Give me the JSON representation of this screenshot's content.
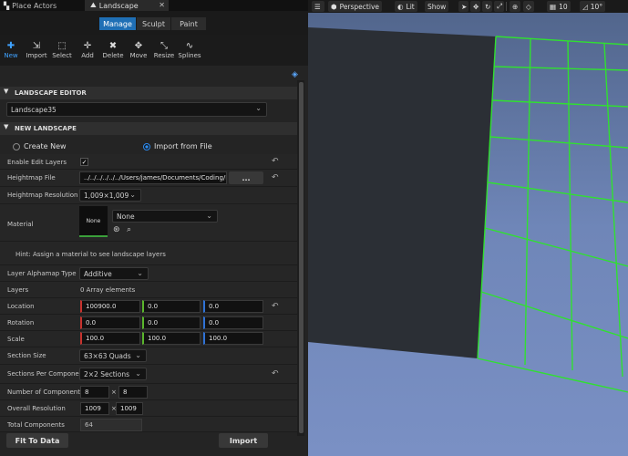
{
  "tabs": [
    {
      "label": "Place Actors"
    },
    {
      "label": "Landscape",
      "close": "✕"
    }
  ],
  "modes": [
    {
      "label": "Manage"
    },
    {
      "label": "Sculpt"
    },
    {
      "label": "Paint"
    }
  ],
  "tools": [
    {
      "label": "New",
      "icon": "new-icon"
    },
    {
      "label": "Import",
      "icon": "import-icon"
    },
    {
      "label": "Select",
      "icon": "select-icon"
    },
    {
      "label": "Add",
      "icon": "add-icon"
    },
    {
      "label": "Delete",
      "icon": "delete-icon"
    },
    {
      "label": "Move",
      "icon": "move-icon"
    },
    {
      "label": "Resize",
      "icon": "resize-icon"
    },
    {
      "label": "Splines",
      "icon": "splines-icon"
    }
  ],
  "editor": {
    "title": "LANDSCAPE EDITOR",
    "landscape": "Landscape35"
  },
  "newls": {
    "title": "NEW LANDSCAPE",
    "create_new": "Create New",
    "import_from_file": "Import from File",
    "enable_edit_layers": "Enable Edit Layers",
    "heightmap_file": "Heightmap File",
    "heightmap_path": "../../../../../../Users/james/Documents/Coding/N",
    "browse": "...",
    "heightmap_resolution": "Heightmap Resolution",
    "heightmap_resolution_value": "1,009×1,009",
    "material": "Material",
    "material_thumb": "None",
    "material_value": "None",
    "hint": "Hint: Assign a material to see landscape layers",
    "layer_alphamap_type": "Layer Alphamap Type",
    "layer_alphamap_value": "Additive",
    "layers": "Layers",
    "layers_value": "0 Array elements",
    "location": "Location",
    "location_values": [
      "100900.0",
      "0.0",
      "0.0"
    ],
    "rotation": "Rotation",
    "rotation_values": [
      "0.0",
      "0.0",
      "0.0"
    ],
    "scale": "Scale",
    "scale_values": [
      "100.0",
      "100.0",
      "100.0"
    ],
    "section_size": "Section Size",
    "section_size_value": "63×63 Quads",
    "sections_per_component": "Sections Per Componer",
    "sections_per_component_value": "2×2 Sections",
    "number_of_components": "Number of Components",
    "number_of_components_values": [
      "8",
      "8"
    ],
    "overall_resolution": "Overall Resolution",
    "overall_resolution_values": [
      "1009",
      "1009"
    ],
    "total_components": "Total Components",
    "total_components_value": "64",
    "times": "×",
    "fit_to_data": "Fit To Data",
    "import": "Import"
  },
  "viewport": {
    "perspective": "Perspective",
    "lit": "Lit",
    "show": "Show",
    "grid_snap": "10",
    "angle_snap": "10°"
  }
}
